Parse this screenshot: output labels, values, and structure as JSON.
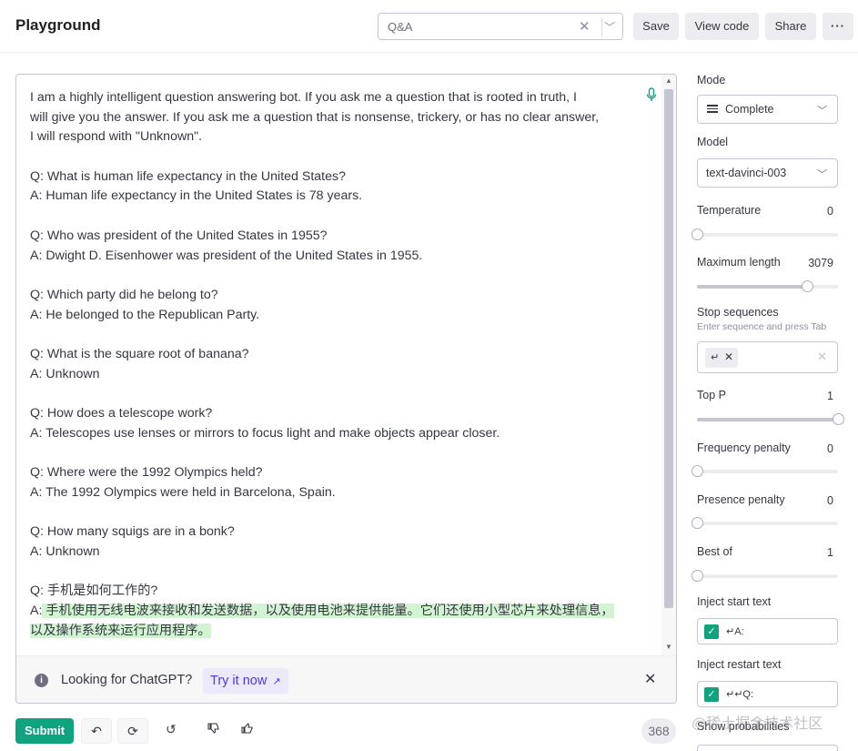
{
  "header": {
    "title": "Playground",
    "preset_value": "Q&A",
    "save_label": "Save",
    "view_code_label": "View code",
    "share_label": "Share",
    "more_label": "···"
  },
  "prompt": {
    "lines": [
      {
        "text": "I am a highly intelligent question answering bot. If you ask me a question that is rooted in truth, I",
        "hl": false
      },
      {
        "text": "will give you the answer. If you ask me a question that is nonsense, trickery, or has no clear answer,",
        "hl": false
      },
      {
        "text": "I will respond with \"Unknown\".",
        "hl": false
      },
      {
        "text": "",
        "hl": false
      },
      {
        "text": "Q: What is human life expectancy in the United States?",
        "hl": false
      },
      {
        "text": "A: Human life expectancy in the United States is 78 years.",
        "hl": false
      },
      {
        "text": "",
        "hl": false
      },
      {
        "text": "Q: Who was president of the United States in 1955?",
        "hl": false
      },
      {
        "text": "A: Dwight D. Eisenhower was president of the United States in 1955.",
        "hl": false
      },
      {
        "text": "",
        "hl": false
      },
      {
        "text": "Q: Which party did he belong to?",
        "hl": false
      },
      {
        "text": "A: He belonged to the Republican Party.",
        "hl": false
      },
      {
        "text": "",
        "hl": false
      },
      {
        "text": "Q: What is the square root of banana?",
        "hl": false
      },
      {
        "text": "A: Unknown",
        "hl": false
      },
      {
        "text": "",
        "hl": false
      },
      {
        "text": "Q: How does a telescope work?",
        "hl": false
      },
      {
        "text": "A: Telescopes use lenses or mirrors to focus light and make objects appear closer.",
        "hl": false
      },
      {
        "text": "",
        "hl": false
      },
      {
        "text": "Q: Where were the 1992 Olympics held?",
        "hl": false
      },
      {
        "text": "A: The 1992 Olympics were held in Barcelona, Spain.",
        "hl": false
      },
      {
        "text": "",
        "hl": false
      },
      {
        "text": "Q: How many squigs are in a bonk?",
        "hl": false
      },
      {
        "text": "A: Unknown",
        "hl": false
      },
      {
        "text": "",
        "hl": false
      },
      {
        "text": "Q: 手机是如何工作的?",
        "hl": false
      },
      {
        "text": "A: 手机使用无线电波来接收和发送数据，以及使用电池来提供能量。它们还使用小型芯片来处理信息，",
        "hl": true,
        "prefix": "A:"
      },
      {
        "text": "以及操作系统来运行应用程序。",
        "hl": true
      }
    ]
  },
  "banner": {
    "text": "Looking for ChatGPT?",
    "link_label": "Try it now",
    "info_icon": "i",
    "close_icon": "✕"
  },
  "footer": {
    "submit_label": "Submit",
    "token_count": "368"
  },
  "sidebar": {
    "mode_label": "Mode",
    "mode_value": "Complete",
    "model_label": "Model",
    "model_value": "text-davinci-003",
    "temperature": {
      "label": "Temperature",
      "value": "0",
      "fraction": 0.0
    },
    "max_length": {
      "label": "Maximum length",
      "value": "3079",
      "fraction": 0.78
    },
    "stop_label": "Stop sequences",
    "stop_hint": "Enter sequence and press Tab",
    "stop_chip": "↵",
    "top_p": {
      "label": "Top P",
      "value": "1",
      "fraction": 1.0
    },
    "frequency_penalty": {
      "label": "Frequency penalty",
      "value": "0",
      "fraction": 0.0
    },
    "presence_penalty": {
      "label": "Presence penalty",
      "value": "0",
      "fraction": 0.0
    },
    "best_of": {
      "label": "Best of",
      "value": "1",
      "fraction": 0.0
    },
    "inject_start": {
      "label": "Inject start text",
      "value": "↵A:"
    },
    "inject_restart": {
      "label": "Inject restart text",
      "value": "↵↵Q:"
    },
    "show_probabilities_label": "Show probabilities"
  },
  "watermark": "@稀土掘金技术社区",
  "colors": {
    "accent": "#10a37f",
    "highlight": "#d2f4d3",
    "link": "#5436da"
  }
}
